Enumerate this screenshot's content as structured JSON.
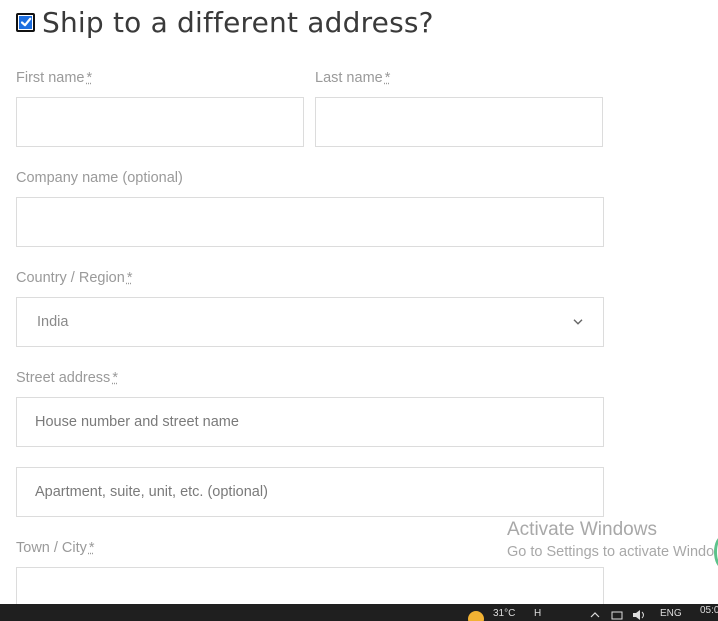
{
  "heading": {
    "checkbox_checked": true,
    "text": "Ship to a different address?"
  },
  "required_marker": "*",
  "fields": {
    "first_name": {
      "label": "First name",
      "value": ""
    },
    "last_name": {
      "label": "Last name",
      "value": ""
    },
    "company": {
      "label": "Company name (optional)",
      "value": ""
    },
    "country": {
      "label": "Country / Region",
      "selected": "India"
    },
    "street": {
      "label": "Street address",
      "placeholder1": "House number and street name",
      "placeholder2": "Apartment, suite, unit, etc. (optional)"
    },
    "town": {
      "label": "Town / City",
      "value": ""
    }
  },
  "watermark": {
    "title": "Activate Windows",
    "subtitle": "Go to Settings to activate Windo"
  },
  "taskbar": {
    "weather": "31°C",
    "weather_extra": "H",
    "lang": "ENG",
    "time": "05:0"
  },
  "colors": {
    "checkbox": "#1e6fe0",
    "border": "#dcdcdc",
    "label": "#9a9a9a",
    "taskbar": "#1f1f1f"
  }
}
